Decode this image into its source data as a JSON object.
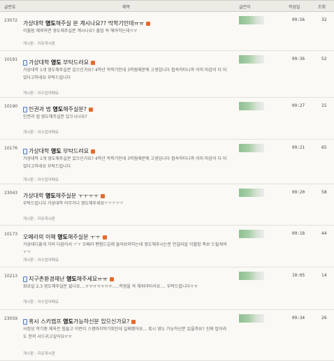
{
  "header": {
    "num": "글번호",
    "title": "제목",
    "author": "글쓴이",
    "date": "작성일",
    "views": "조회"
  },
  "rows": [
    {
      "num": "23072",
      "has_pc_icon": false,
      "title_pre": "가상대학 ",
      "title_bold": "영도",
      "title_post": "해주실 분 계시나요?? 막학기인데ㅠㅠ",
      "preview": "이월점 제외하면 영도해주실분 계시나요? 졸업 꼭 해야하는데ㅠㅠ",
      "board": "게시판 : 자유게시판",
      "time": "09:56",
      "views": "32"
    },
    {
      "num": "10191",
      "has_pc_icon": true,
      "title_pre": "가상대학 ",
      "title_bold": "영도",
      "title_post": " 부탁드려요",
      "preview": "가상대학 1개 영도해주실분 있으신가요? 4학년 막학기인데 3학점때문에 고생입니다 접속하티니까 이미 마감이 다 되었다고하네요 부탁드립니다",
      "board": "게시판 : 이수업어때요",
      "time": "09:36",
      "views": "52"
    },
    {
      "num": "10190",
      "has_pc_icon": true,
      "title_pre": "인권과 법 ",
      "title_bold": "영도",
      "title_post": "해주실분?",
      "preview": "인권과 법 영도해주실분 있으시나요?",
      "board": "게시판 : 이수업어때요",
      "time": "09:27",
      "views": "15"
    },
    {
      "num": "10176",
      "has_pc_icon": true,
      "title_pre": "가상대학 ",
      "title_bold": "영도",
      "title_post": " 부탁드려요",
      "preview": "가상대학 1개 영도해주실분 있으신가요? 4학년 막학기인데 3학점때문에 고생입니다 접속하티니까 이미 마감이 다 되었다고하네요 부탁드립니다",
      "board": "게시판 : 이수업어때요",
      "time": "09:21",
      "views": "65"
    },
    {
      "num": "23043",
      "has_pc_icon": false,
      "title_pre": "가상대학 ",
      "title_bold": "영도",
      "title_post": "해주실분 ㅜㅜㅜㅜ",
      "preview": "부탁드립니다 가상대학 아무거나 영도해주세요ㅜㅜㅜㅜㅜ",
      "board": "게시판 : 자유게시판",
      "time": "09:20",
      "views": "58"
    },
    {
      "num": "10173",
      "has_pc_icon": false,
      "title_pre": "오페라의 이해 ",
      "title_bold": "영도",
      "title_post": "해주실분 ㅜㅜ",
      "preview": "가상대디흥게 거의 다음어서 ㅜㅜ 오페라 펜첨드김래 들어보려하는데 영도해주시는분 인걸라알 이월함 촉보 드릴게여 ㅜㅜ",
      "board": "게시판 : 이수업어때요",
      "time": "09:18",
      "views": "44"
    },
    {
      "num": "10213",
      "has_pc_icon": true,
      "title_pre": "지구촌환경재난 ",
      "title_bold": "영도",
      "title_post": "해주세요ㅠㅠ",
      "preview": "화요일 2,3 영도해주실분 없나요....ㅠㅠㅠㅠㅠㅠㅠ.....학점을 꼭 채워야되서요.... 부탁드립니다ㅠㅠ",
      "board": "게시판 : 이수업어때요",
      "time": "10:05",
      "views": "14"
    },
    {
      "num": "23059",
      "has_pc_icon": true,
      "title_pre": "혹시 스키캠프 ",
      "title_bold": "영도",
      "title_post": "가능하신분 있으신가요?",
      "preview": "사정상 학기중 체육은 힘들고 이번이 스캠마지막기회인데 실패했어요... 혹시 영도 가능하신분 있을까요? 진짜 밥이라도 한끼 사드리고싶어요ㅠㅠ",
      "board": "게시판 : 자유게시판",
      "time": "09:34",
      "views": "26"
    }
  ]
}
